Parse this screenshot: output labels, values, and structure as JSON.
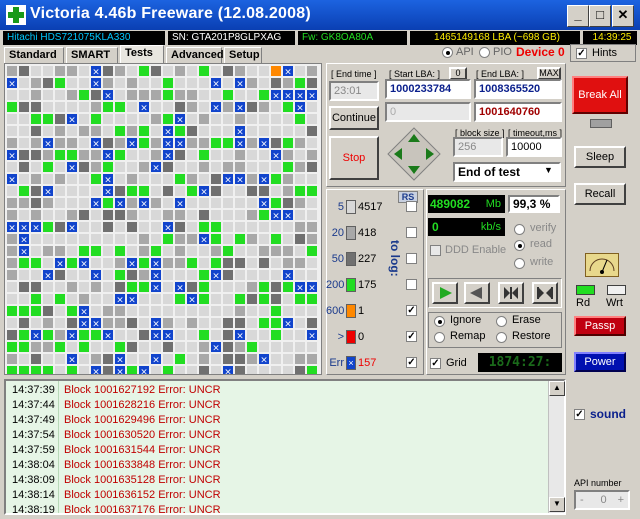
{
  "window": {
    "title": "Victoria 4.46b Freeware (12.08.2008)"
  },
  "infobar": {
    "model": "Hitachi HDS721075KLA330",
    "serial": "SN: GTA201P8GLPXAG",
    "firmware": "Fw: GK8OA80A",
    "lba": "1465149168 LBA (~698 GB)",
    "clock": "14:39:25"
  },
  "tabs": [
    "Standard",
    "SMART",
    "Tests",
    "Advanced",
    "Setup"
  ],
  "active_tab": "Tests",
  "mode": {
    "api": "API",
    "pio": "PIO",
    "device": "Device 0",
    "hints": "Hints"
  },
  "time_lba": {
    "end_time_label": "[ End time ]",
    "end_time_value": "23:01",
    "start_lba_label": "[ Start LBA: ]",
    "start_lba_zero": "0",
    "end_lba_label": "[ End LBA: ]",
    "end_lba_max": "MAX",
    "start_lba_value": "1000233784",
    "end_lba_value": "1008365520",
    "current_lba_a": "0",
    "current_lba_b": "1001640760"
  },
  "controls": {
    "continue": "Continue",
    "stop": "Stop",
    "block_size_label": "[ block size ]",
    "block_size": "256",
    "timeout_label": "[ timeout,ms ]",
    "timeout": "10000",
    "end_of_test": "End of test"
  },
  "stats": {
    "rs": "RS",
    "to_log": "to log:",
    "rows": [
      {
        "ms": "5",
        "count": "4517",
        "color": "#d8d8d8",
        "logged": false
      },
      {
        "ms": "20",
        "count": "418",
        "color": "#a8a8a8",
        "logged": false
      },
      {
        "ms": "50",
        "count": "227",
        "color": "#707070",
        "logged": false
      },
      {
        "ms": "200",
        "count": "175",
        "color": "#22dd22",
        "logged": false
      },
      {
        "ms": "600",
        "count": "1",
        "color": "#ff8800",
        "logged": true
      },
      {
        "ms": ">",
        "count": "0",
        "color": "#ee0000",
        "logged": true
      },
      {
        "ms": "Err",
        "count": "157",
        "color": "#1144cc",
        "logged": true
      }
    ]
  },
  "speed": {
    "position_mb": "489082",
    "position_unit": "Mb",
    "percent": "99,3",
    "percent_unit": "%",
    "speed": "0",
    "speed_unit": "kb/s",
    "ddd": "DDD Enable",
    "verify": "verify",
    "read": "read",
    "write": "write"
  },
  "actions": {
    "ignore": "Ignore",
    "erase": "Erase",
    "remap": "Remap",
    "restore": "Restore",
    "grid": "Grid",
    "grid_counter": "1874:27:"
  },
  "right": {
    "break_all": "Break All",
    "sleep": "Sleep",
    "recall": "Recall",
    "rd": "Rd",
    "wrt": "Wrt",
    "passp": "Passp",
    "power": "Power",
    "sound": "sound",
    "api_number_label": "API number",
    "api_number": "0"
  },
  "log": [
    {
      "time": "14:37:39",
      "msg": "Block 1001627192 Error: UNCR"
    },
    {
      "time": "14:37:44",
      "msg": "Block 1001628216 Error: UNCR"
    },
    {
      "time": "14:37:49",
      "msg": "Block 1001629496 Error: UNCR"
    },
    {
      "time": "14:37:54",
      "msg": "Block 1001630520 Error: UNCR"
    },
    {
      "time": "14:37:59",
      "msg": "Block 1001631544 Error: UNCR"
    },
    {
      "time": "14:38:04",
      "msg": "Block 1001633848 Error: UNCR"
    },
    {
      "time": "14:38:09",
      "msg": "Block 1001635128 Error: UNCR"
    },
    {
      "time": "14:38:14",
      "msg": "Block 1001636152 Error: UNCR"
    },
    {
      "time": "14:38:19",
      "msg": "Block 1001637176 Error: UNCR"
    }
  ]
}
